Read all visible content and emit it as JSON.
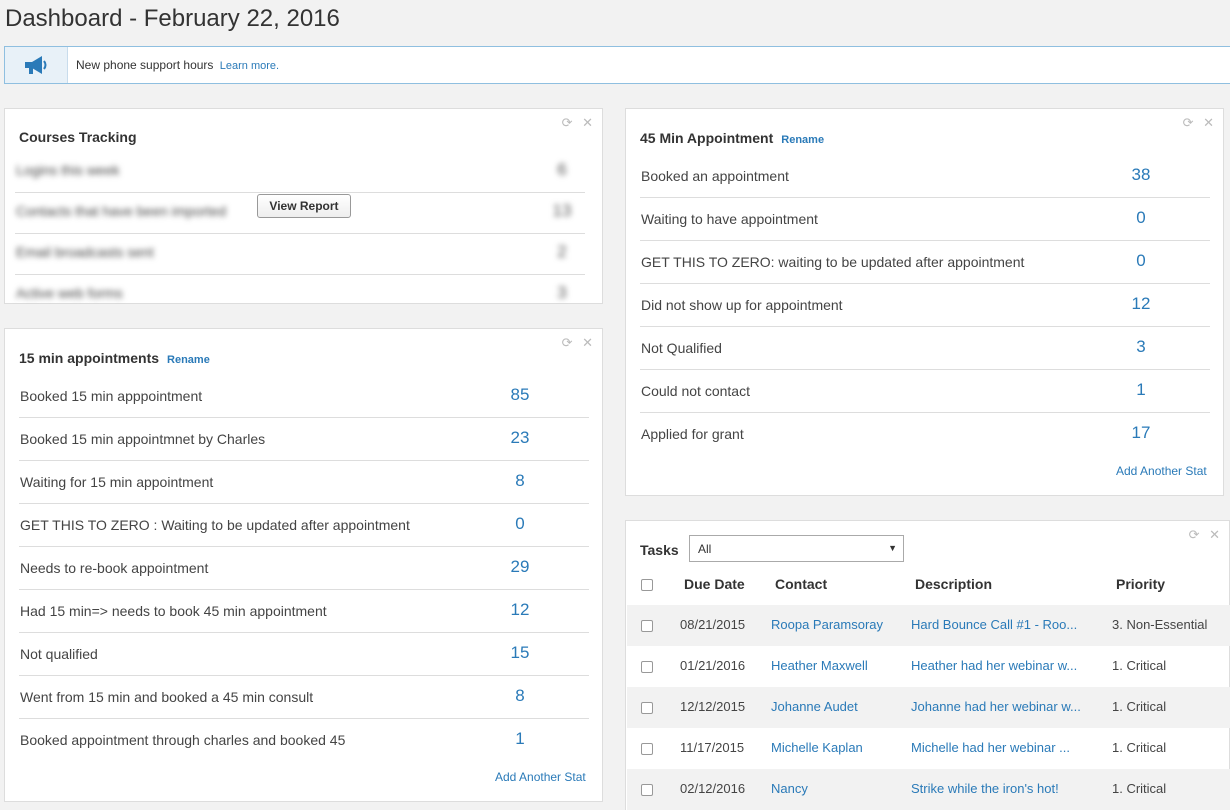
{
  "page": {
    "title": "Dashboard - February 22, 2016"
  },
  "announcement": {
    "text": "New phone support hours",
    "link": "Learn more."
  },
  "courses": {
    "title": "Courses Tracking",
    "rows": [
      {
        "label": "Logins this week",
        "value": "6"
      },
      {
        "label": "Contacts that have been imported",
        "value": "13"
      },
      {
        "label": "Email broadcasts sent",
        "value": "2"
      },
      {
        "label": "Active web forms",
        "value": "3"
      }
    ],
    "view_report": "View Report"
  },
  "fifteen": {
    "title": "15 min appointments",
    "rename": "Rename",
    "rows": [
      {
        "label": "Booked 15 min apppointment",
        "value": "85"
      },
      {
        "label": "Booked 15 min appointmnet by Charles",
        "value": "23"
      },
      {
        "label": "Waiting for 15 min appointment",
        "value": "8"
      },
      {
        "label": "GET THIS TO ZERO : Waiting to be updated after appointment",
        "value": "0"
      },
      {
        "label": "Needs to re-book appointment",
        "value": "29"
      },
      {
        "label": "Had 15 min=> needs to book 45 min appointment",
        "value": "12"
      },
      {
        "label": "Not qualified",
        "value": "15"
      },
      {
        "label": "Went from 15 min and booked a 45 min consult",
        "value": "8"
      },
      {
        "label": "Booked appointment through charles and booked 45",
        "value": "1"
      }
    ],
    "add_stat": "Add Another Stat"
  },
  "fortyfive": {
    "title": "45 Min Appointment",
    "rename": "Rename",
    "rows": [
      {
        "label": "Booked an appointment",
        "value": "38"
      },
      {
        "label": "Waiting to have appointment",
        "value": "0"
      },
      {
        "label": "GET THIS TO ZERO: waiting to be updated after appointment",
        "value": "0"
      },
      {
        "label": "Did not show up for appointment",
        "value": "12"
      },
      {
        "label": "Not Qualified",
        "value": "3"
      },
      {
        "label": "Could not contact",
        "value": "1"
      },
      {
        "label": "Applied for grant",
        "value": "17"
      }
    ],
    "add_stat": "Add Another Stat"
  },
  "tasks": {
    "title": "Tasks",
    "filter": "All",
    "headers": {
      "due": "Due Date",
      "contact": "Contact",
      "desc": "Description",
      "priority": "Priority"
    },
    "rows": [
      {
        "due": "08/21/2015",
        "contact": "Roopa Paramsoray",
        "desc": "Hard Bounce Call #1 - Roo...",
        "priority": "3. Non-Essential"
      },
      {
        "due": "01/21/2016",
        "contact": "Heather Maxwell",
        "desc": "Heather had her webinar w...",
        "priority": "1. Critical"
      },
      {
        "due": "12/12/2015",
        "contact": "Johanne Audet",
        "desc": "Johanne had her webinar w...",
        "priority": "1. Critical"
      },
      {
        "due": "11/17/2015",
        "contact": "Michelle Kaplan",
        "desc": "Michelle had her webinar ...",
        "priority": "1. Critical"
      },
      {
        "due": "02/12/2016",
        "contact": "Nancy",
        "desc": "Strike while the iron's hot!",
        "priority": "1. Critical"
      }
    ]
  },
  "controls": {
    "refresh": "⟳",
    "close": "✕"
  },
  "icons": {
    "announce": "megaphone-icon",
    "accent": "#2a7ab8"
  }
}
